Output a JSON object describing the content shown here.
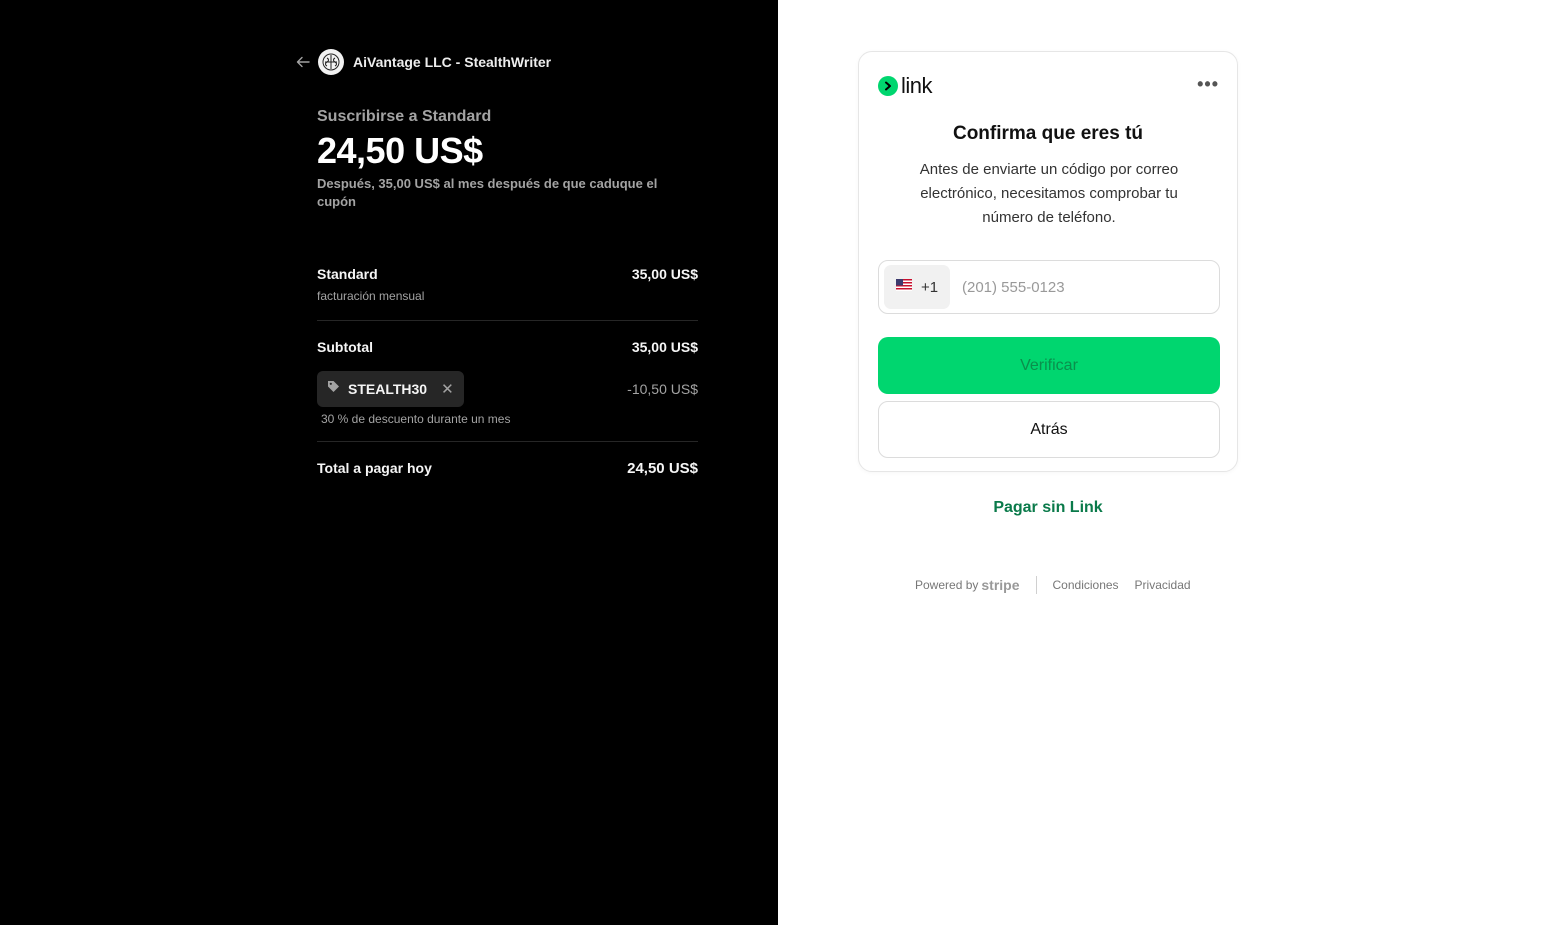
{
  "merchant": {
    "name": "AiVantage LLC - StealthWriter"
  },
  "summary": {
    "subscribe_label": "Suscribirse a Standard",
    "price": "24,50 US$",
    "after_note": "Después, 35,00 US$ al mes después de que caduque el cupón"
  },
  "line_items": {
    "plan_name": "Standard",
    "plan_billing": "facturación mensual",
    "plan_amount": "35,00 US$",
    "subtotal_label": "Subtotal",
    "subtotal_amount": "35,00 US$",
    "coupon_code": "STEALTH30",
    "discount_amount": "-10,50 US$",
    "coupon_note": "30 % de descuento durante un mes",
    "total_label": "Total a pagar hoy",
    "total_amount": "24,50 US$"
  },
  "link_card": {
    "brand": "link",
    "title": "Confirma que eres tú",
    "description": "Antes de enviarte un código por correo electrónico, necesitamos comprobar tu número de teléfono.",
    "country_code": "+1",
    "phone_placeholder": "(201) 555-0123",
    "verify_label": "Verificar",
    "back_label": "Atrás"
  },
  "pay_without_link": "Pagar sin Link",
  "footer": {
    "powered_by": "Powered by",
    "stripe": "stripe",
    "terms": "Condiciones",
    "privacy": "Privacidad"
  },
  "colors": {
    "link_green": "#00d66f",
    "link_text_green": "#0a7a4a",
    "left_bg": "#000000"
  }
}
